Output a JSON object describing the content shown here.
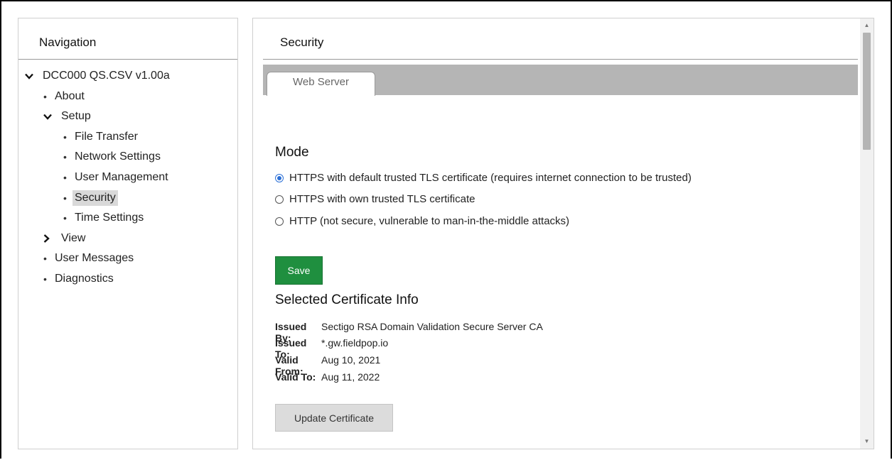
{
  "navigation": {
    "title": "Navigation",
    "items": [
      {
        "label": "DCC000 QS.CSV v1.00a",
        "level": 0,
        "marker": "chevron-down",
        "selected": false
      },
      {
        "label": "About",
        "level": 1,
        "marker": "bullet",
        "selected": false
      },
      {
        "label": "Setup",
        "level": 1,
        "marker": "chevron-down",
        "selected": false
      },
      {
        "label": "File Transfer",
        "level": 2,
        "marker": "bullet",
        "selected": false
      },
      {
        "label": "Network Settings",
        "level": 2,
        "marker": "bullet",
        "selected": false
      },
      {
        "label": "User Management",
        "level": 2,
        "marker": "bullet",
        "selected": false
      },
      {
        "label": "Security",
        "level": 2,
        "marker": "bullet",
        "selected": true
      },
      {
        "label": "Time Settings",
        "level": 2,
        "marker": "bullet",
        "selected": false
      },
      {
        "label": "View",
        "level": 1,
        "marker": "chevron-right",
        "selected": false
      },
      {
        "label": "User Messages",
        "level": 1,
        "marker": "bullet",
        "selected": false
      },
      {
        "label": "Diagnostics",
        "level": 1,
        "marker": "bullet",
        "selected": false
      }
    ]
  },
  "main": {
    "title": "Security",
    "tabs": [
      {
        "label": "Web Server",
        "active": true
      }
    ],
    "mode": {
      "heading": "Mode",
      "options": [
        {
          "label": "HTTPS with default trusted TLS certificate (requires internet connection to be trusted)",
          "checked": true
        },
        {
          "label": "HTTPS with own trusted TLS certificate",
          "checked": false
        },
        {
          "label": "HTTP (not secure, vulnerable to man-in-the-middle attacks)",
          "checked": false
        }
      ]
    },
    "save_label": "Save",
    "certificate": {
      "heading": "Selected Certificate Info",
      "rows": [
        {
          "key": "Issued By:",
          "value": "Sectigo RSA Domain Validation Secure Server CA"
        },
        {
          "key": "Issued To:",
          "value": "*.gw.fieldpop.io"
        },
        {
          "key": "Valid From:",
          "value": "Aug 10, 2021"
        },
        {
          "key": "Valid To:",
          "value": "Aug 11, 2022"
        }
      ]
    },
    "update_label": "Update Certificate"
  },
  "colors": {
    "save_button": "#1f8f3f",
    "radio_accent": "#2a6fd6",
    "tabbar": "#b5b5b5",
    "selected_nav": "#d9d9d9"
  },
  "icons": {
    "expanded": "chevron-down-icon",
    "collapsed": "chevron-right-icon",
    "bullet": "bullet-icon"
  }
}
